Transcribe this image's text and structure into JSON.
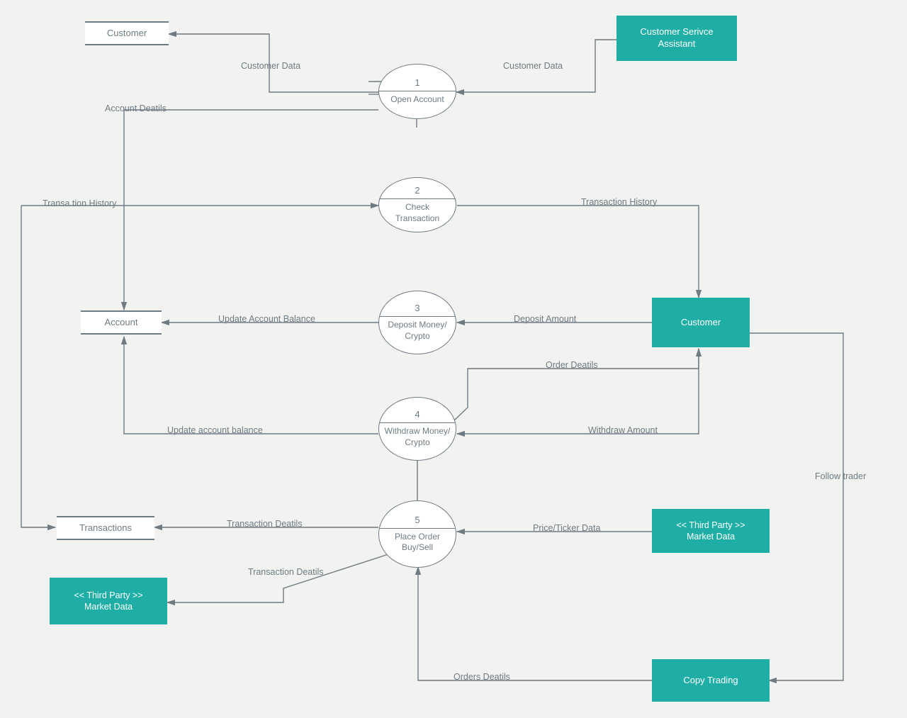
{
  "colors": {
    "bg": "#f2f2f0",
    "stroke": "#6e7b82",
    "teal": "#1eaea5",
    "text": "#6e7b82"
  },
  "entities": {
    "customer_top": "Customer",
    "csa": "Customer Serivce Assistant",
    "customer_right": "Customer",
    "account": "Account",
    "transactions": "Transactions",
    "market_data_left_line1": "<< Third Party >>",
    "market_data_left_line2": "Market Data",
    "market_data_right_line1": "<< Third Party >>",
    "market_data_right_line2": "Market Data",
    "copy_trading": "Copy Trading"
  },
  "processes": {
    "p1": {
      "num": "1",
      "label": "Open Account"
    },
    "p2": {
      "num": "2",
      "label": "Check Transaction"
    },
    "p3": {
      "num": "3",
      "label": "Deposit Money/\nCrypto"
    },
    "p4": {
      "num": "4",
      "label": "Withdraw Money/\nCrypto"
    },
    "p5": {
      "num": "5",
      "label": "Place Order\nBuy/Sell"
    }
  },
  "flows": {
    "cd1": "Customer Data",
    "cd2": "Customer Data",
    "account_details": "Account Deatils",
    "transaction_history_left": "Transa tion History",
    "transaction_history_right": "Transaction History",
    "update_balance_1": "Update Account Balance",
    "update_balance_2": "Update account balance",
    "deposit_amount": "Deposit Amount",
    "withdraw_amount": "Withdraw Amount",
    "order_details": "Order Deatils",
    "transaction_details_1": "Transaction Deatils",
    "transaction_details_2": "Transaction Deatils",
    "price_ticker": "Price/Ticker Data",
    "orders_details": "Orders Deatils",
    "follow_trader": "Follow trader"
  }
}
